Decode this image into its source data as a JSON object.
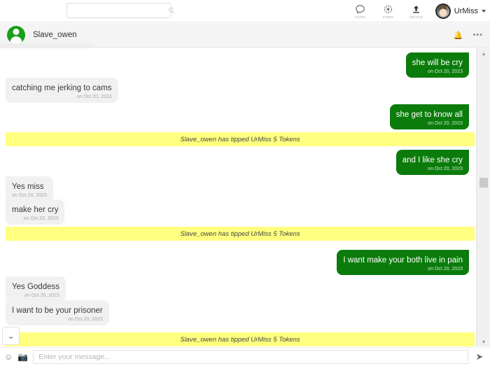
{
  "topbar": {
    "search": {
      "value": "",
      "placeholder": ""
    },
    "nav": [
      {
        "label": "CHATS",
        "icon": "chat-bubble-icon"
      },
      {
        "label": "STORY",
        "icon": "story-plus-icon"
      },
      {
        "label": "UPLOAD",
        "icon": "upload-arrow-icon"
      }
    ],
    "user": {
      "name": "UrMiss"
    }
  },
  "chat_header": {
    "peer_name": "Slave_owen",
    "bell_icon": "🔔",
    "more_icon": "•••"
  },
  "conversation": [
    {
      "type": "out",
      "text": "she will be cry",
      "time": "on Oct 20, 2023"
    },
    {
      "type": "in",
      "text": "catching me jerking to cams",
      "time": "on Oct 20, 2023"
    },
    {
      "type": "out",
      "text": "she get to know all",
      "time": "on Oct 20, 2023"
    },
    {
      "type": "tip",
      "text": "Slave_owen has tipped UrMiss 5 Tokens"
    },
    {
      "type": "out",
      "text": "and I like she cry",
      "time": "on Oct 20, 2023"
    },
    {
      "type": "in",
      "text": "Yes miss",
      "time": "on Oct 20, 2023"
    },
    {
      "type": "in",
      "text": "make her cry",
      "time": "on Oct 20, 2023"
    },
    {
      "type": "tip",
      "text": "Slave_owen has tipped UrMiss 5 Tokens"
    },
    {
      "type": "out",
      "text": "I want make your both live in pain",
      "time": "on Oct 20, 2023"
    },
    {
      "type": "in",
      "text": "Yes Goddess",
      "time": "on Oct 20, 2023"
    },
    {
      "type": "in",
      "text": "I want to be your prisoner",
      "time": "on Oct 20, 2023"
    },
    {
      "type": "tip",
      "text": "Slave_owen has tipped UrMiss 5 Tokens"
    }
  ],
  "composer": {
    "emoji_icon": "☺",
    "camera_icon": "📷",
    "input_value": "",
    "input_placeholder": "Enter your message...",
    "send_icon": "➤"
  },
  "collapse": {
    "icon": "⌄"
  },
  "scrollbar": {
    "up": "▴",
    "down": "▾"
  },
  "colors": {
    "outgoing_bubble": "#0b7c0b",
    "incoming_bubble": "#f1f1f1",
    "tip_banner": "#ffff80",
    "avatar_green": "#18a018"
  }
}
